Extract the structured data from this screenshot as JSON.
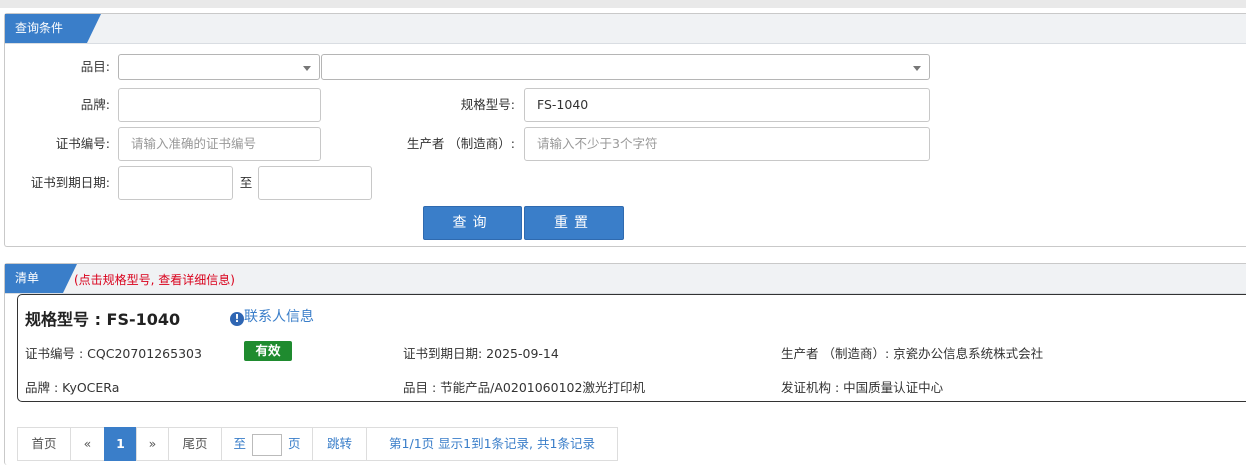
{
  "query_panel": {
    "tab_label": "查询条件",
    "category_label": "品目:",
    "category_select_1": "",
    "category_select_2": "",
    "brand_label": "品牌:",
    "brand_value": "",
    "model_label": "规格型号:",
    "model_value": "FS-1040",
    "cert_no_label": "证书编号:",
    "cert_no_placeholder": "请输入准确的证书编号",
    "producer_label": "生产者 （制造商）:",
    "producer_placeholder": "请输入不少于3个字符",
    "expiry_label": "证书到期日期:",
    "expiry_to": "至",
    "query_button": "查询",
    "reset_button": "重置"
  },
  "list_panel": {
    "tab_label": "清单",
    "hint": "(点击规格型号, 查看详细信息)",
    "result": {
      "title": "规格型号 : FS-1040",
      "contact_link": "联系人信息",
      "cert_no": "证书编号 : CQC20701265303",
      "status_badge": "有效",
      "status_color": "#1f8b2f",
      "expiry": "证书到期日期: 2025-09-14",
      "producer": "生产者 （制造商）: 京瓷办公信息系统株式会社",
      "brand": "品牌 : KyOCERa",
      "category": "品目 : 节能产品/A0201060102激光打印机",
      "issuer": "发证机构 : 中国质量认证中心"
    }
  },
  "pagination": {
    "first": "首页",
    "prev": "«",
    "current": "1",
    "next": "»",
    "last": "尾页",
    "goto_prefix": "至",
    "goto_suffix": "页",
    "jump": "跳转",
    "summary": "第1/1页  显示1到1条记录, 共1条记录"
  },
  "colors": {
    "accent": "#3a7ec9",
    "hint_red": "#d9001b",
    "valid_green": "#1f8b2f"
  }
}
